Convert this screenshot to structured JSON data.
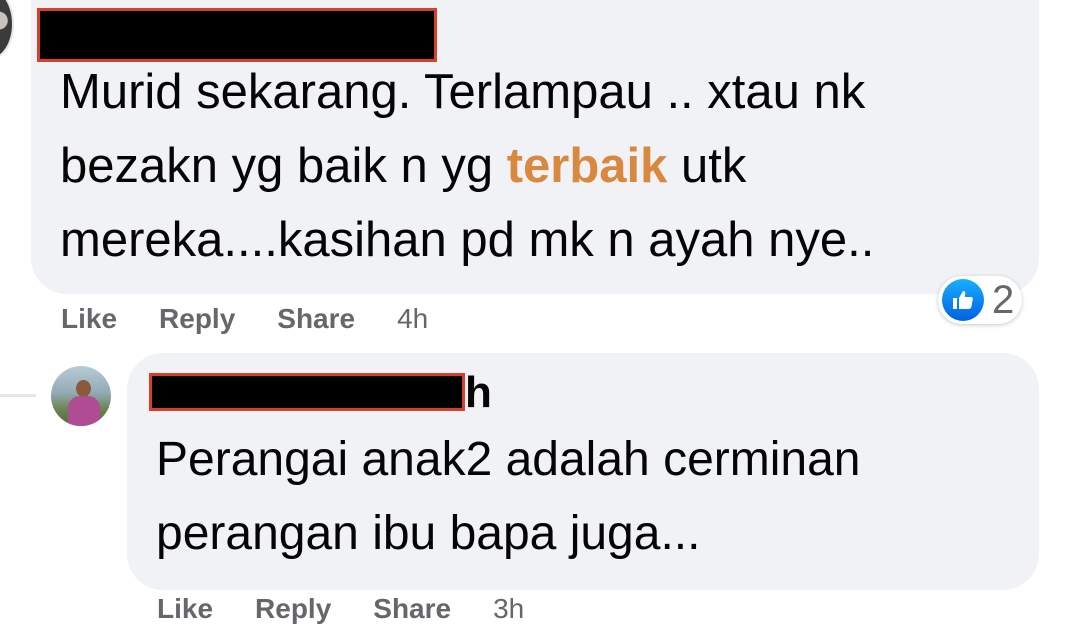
{
  "comments": [
    {
      "text_lines": [
        "Murid sekarang. Terlampau .. xtau nk",
        "bezakn yg baik n yg ",
        "mereka....kasihan pd mk n ayah nye.."
      ],
      "highlight_word": "terbaik",
      "line2_after": " utk",
      "actions": {
        "like": "Like",
        "reply": "Reply",
        "share": "Share",
        "time": "4h"
      },
      "reaction": {
        "icon": "like-icon",
        "count": "2",
        "color": "#1877f2"
      }
    },
    {
      "name_tail": "h",
      "text_lines": [
        "Perangai anak2 adalah cerminan",
        "perangan ibu bapa juga..."
      ],
      "actions": {
        "like": "Like",
        "reply": "Reply",
        "share": "Share",
        "time": "3h"
      }
    }
  ],
  "colors": {
    "bubble": "#f0f2f5",
    "highlight": "#d9883f",
    "muted": "#65676b",
    "redaction_border": "#d7402c"
  }
}
